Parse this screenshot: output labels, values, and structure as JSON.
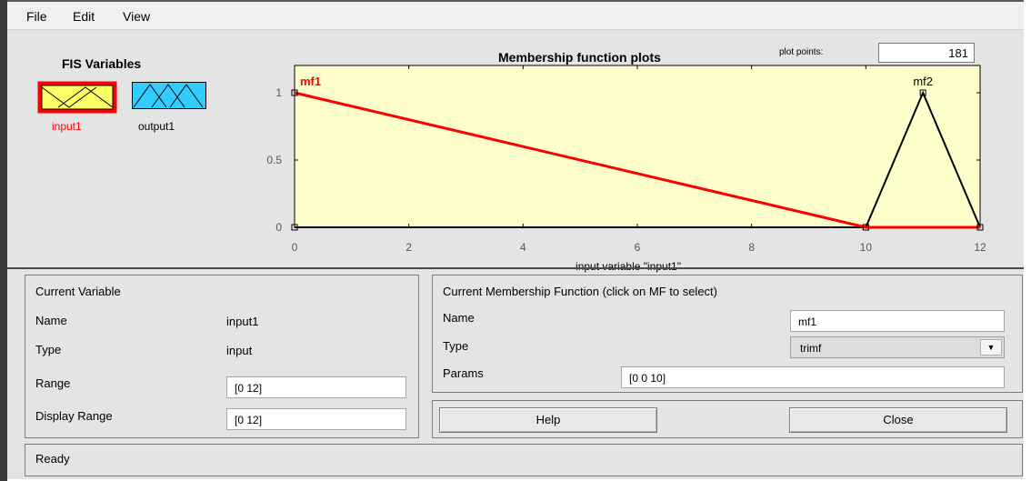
{
  "menu": {
    "file": "File",
    "edit": "Edit",
    "view": "View"
  },
  "fis_variables": {
    "title": "FIS Variables",
    "input_label": "input1",
    "output_label": "output1",
    "selected_color": "#ff0000",
    "input_fill": "#ffff66",
    "output_fill": "#33ccff"
  },
  "plot": {
    "title": "Membership function plots",
    "plot_points_label": "plot points:",
    "plot_points_value": "181"
  },
  "chart_data": {
    "type": "line",
    "title": "Membership function plots",
    "xlabel": "input variable \"input1\"",
    "ylabel": "",
    "xlim": [
      0,
      12
    ],
    "ylim": [
      0,
      1
    ],
    "x_ticks": [
      "0",
      "2",
      "4",
      "6",
      "8",
      "10",
      "12"
    ],
    "y_ticks": [
      "0",
      "0.5",
      "1"
    ],
    "background": "#ffffcc",
    "series": [
      {
        "name": "mf1",
        "color": "#ff0000",
        "selected": true,
        "points": [
          [
            0,
            1
          ],
          [
            10,
            0
          ],
          [
            12,
            0
          ]
        ]
      },
      {
        "name": "mf2",
        "color": "#000000",
        "selected": false,
        "points": [
          [
            0,
            0
          ],
          [
            10,
            0
          ],
          [
            11,
            1
          ],
          [
            12,
            0
          ]
        ]
      }
    ]
  },
  "current_variable": {
    "title": "Current Variable",
    "name_label": "Name",
    "name_value": "input1",
    "type_label": "Type",
    "type_value": "input",
    "range_label": "Range",
    "range_value": "[0 12]",
    "display_range_label": "Display Range",
    "display_range_value": "[0 12]"
  },
  "current_mf": {
    "title": "Current Membership Function (click on MF to select)",
    "name_label": "Name",
    "name_value": "mf1",
    "type_label": "Type",
    "type_value": "trimf",
    "params_label": "Params",
    "params_value": "[0 0 10]"
  },
  "buttons": {
    "help": "Help",
    "close": "Close"
  },
  "status": "Ready"
}
